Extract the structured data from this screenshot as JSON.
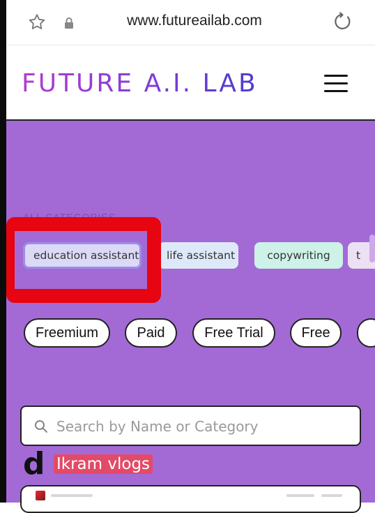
{
  "browser": {
    "url": "www.futureailab.com"
  },
  "header": {
    "logo": "FUTURE A.I. LAB"
  },
  "categories": {
    "heading": "ALL CATEGORIES",
    "tags": [
      {
        "label": "education assistant"
      },
      {
        "label": "life assistant"
      },
      {
        "label": "copywriting"
      },
      {
        "label": "t"
      }
    ]
  },
  "filters": [
    "Freemium",
    "Paid",
    "Free Trial",
    "Free",
    ""
  ],
  "search": {
    "placeholder": "Search by Name or Category"
  },
  "watermark": {
    "logo": "d",
    "text": "Ikram vlogs"
  },
  "colors": {
    "main_bg": "#a36ad6",
    "highlight_red": "#e60510",
    "logo_gradient_start": "#b13ccf",
    "logo_gradient_end": "#4b3bd0"
  }
}
